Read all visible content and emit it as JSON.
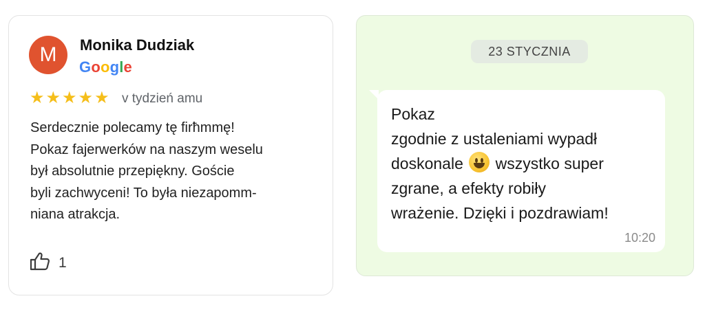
{
  "review": {
    "avatar_letter": "M",
    "author": "Monika Dudziak",
    "source_logo": [
      "G",
      "o",
      "o",
      "g",
      "l",
      "e"
    ],
    "source_logo_colors": [
      "#4285F4",
      "#EA4335",
      "#FBBC05",
      "#4285F4",
      "#34A853",
      "#EA4335"
    ],
    "rating": 5,
    "rating_max": 5,
    "star_color": "#F5BE1A",
    "time": "v tydzień  amu",
    "text_lines": [
      "Serdecznie polecamy tę firħmmę!",
      "Pokaz fajerwerków na naszym weselu",
      "był absolutnie przepiękny. Goście",
      "byli zachwyceni! To była niezapomm-",
      "niana atrakcja."
    ],
    "like_icon": "thumbs-up-icon",
    "like_count": "1"
  },
  "chat": {
    "date_chip": "23 STYCZNIA",
    "background_color": "#EEFBE3",
    "message": {
      "lines": [
        "Pokaz",
        "zgodnie z ustaleniami wypadł",
        "doskonale",
        "wszystko super",
        "zgrane, a efekty robiły",
        "wrażenie. Dzięki i pozdrawiam!"
      ],
      "emoji": "smiling-face-emoji",
      "time": "10:20"
    }
  }
}
